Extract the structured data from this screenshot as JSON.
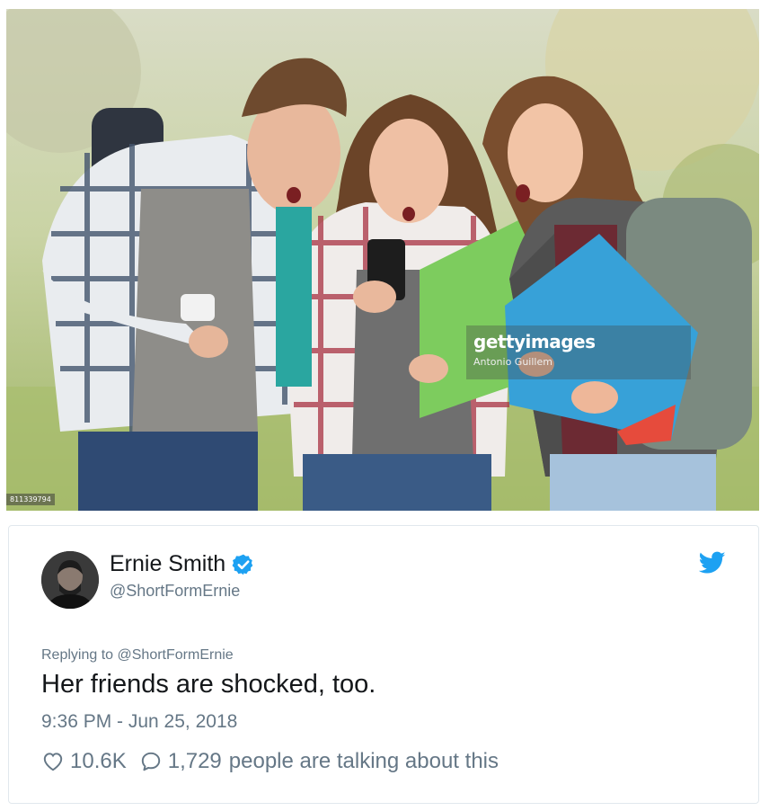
{
  "photo": {
    "watermark_brand": "gettyimages",
    "watermark_credit": "Antonio Guillem",
    "stock_id": "811339794"
  },
  "tweet": {
    "display_name": "Ernie Smith",
    "handle": "@ShortFormErnie",
    "reply_prefix": "Replying to",
    "reply_to": "@ShortFormErnie",
    "text": "Her friends are shocked, too.",
    "timestamp": "9:36 PM - Jun 25, 2018",
    "likes": "10.6K",
    "replies": "1,729",
    "talking_label": "people are talking about this"
  },
  "colors": {
    "verified": "#1da1f2",
    "twitter_blue": "#1da1f2",
    "muted": "#657786",
    "text": "#14171a"
  },
  "icons": {
    "verified": "verified-badge-icon",
    "bird": "twitter-bird-icon",
    "like": "heart-outline-icon",
    "reply": "speech-bubble-icon"
  }
}
